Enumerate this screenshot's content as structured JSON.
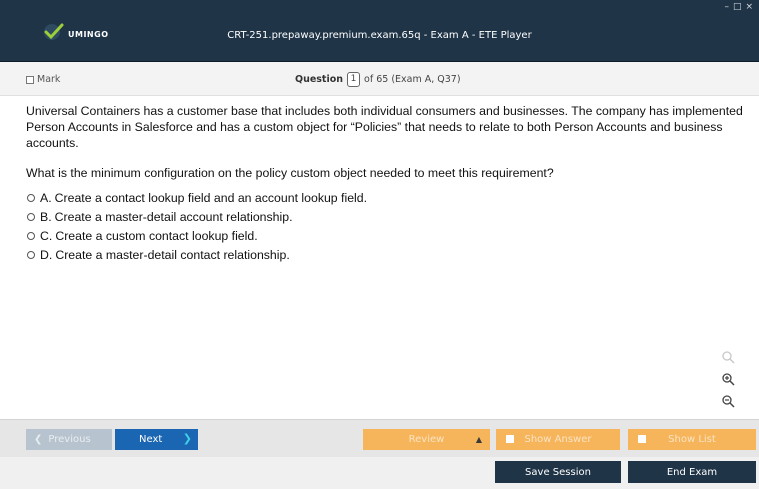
{
  "window": {
    "title": "CRT-251.prepaway.premium.exam.65q - Exam A - ETE Player",
    "logo_text": "UMINGO",
    "controls": [
      "–",
      "□",
      "×"
    ]
  },
  "header": {
    "mark_label": "Mark",
    "question_word": "Question",
    "current": "1",
    "of_text": "of 65 (Exam A, Q37)"
  },
  "question": {
    "text": "Universal Containers has a customer base that includes both individual consumers and businesses. The company has implemented Person Accounts in Salesforce and has a custom object for “Policies” that needs to relate to both Person Accounts and business accounts.",
    "prompt": "What is the minimum configuration on the policy custom object needed to meet this requirement?",
    "options": [
      {
        "letter": "A.",
        "text": "Create a contact lookup field and an account lookup field."
      },
      {
        "letter": "B.",
        "text": "Create a master-detail account relationship."
      },
      {
        "letter": "C.",
        "text": "Create a custom contact lookup field."
      },
      {
        "letter": "D.",
        "text": "Create a master-detail contact relationship."
      }
    ]
  },
  "tools": [
    "search-icon",
    "zoom-in-icon",
    "zoom-out-icon"
  ],
  "nav": {
    "previous": "Previous",
    "next": "Next",
    "review": "Review",
    "show_answer": "Show Answer",
    "show_list": "Show List",
    "save_session": "Save Session",
    "end_exam": "End Exam"
  },
  "colors": {
    "titlebar": "#1f3447",
    "next": "#1b66b3",
    "orange": "#f6b55a"
  }
}
